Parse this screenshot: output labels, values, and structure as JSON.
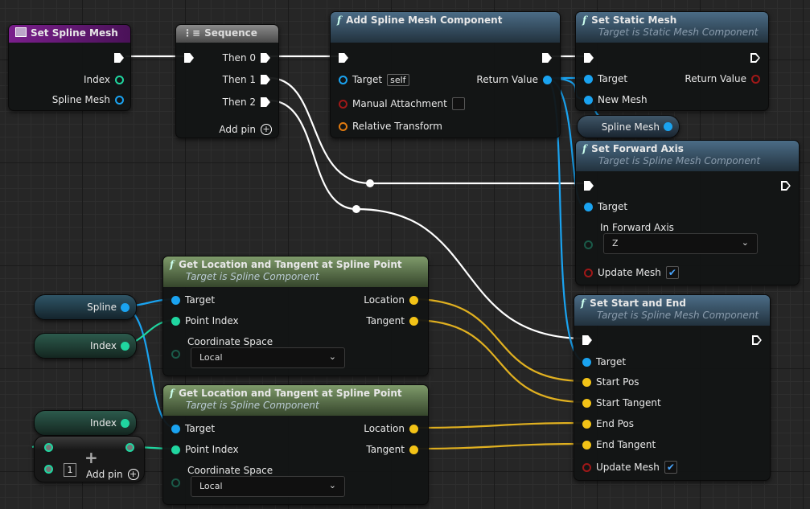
{
  "nodes": {
    "set_spline_mesh": {
      "title": "Set Spline Mesh",
      "pins": [
        "Index",
        "Spline Mesh"
      ]
    },
    "sequence": {
      "title": "Sequence",
      "pins": [
        "Then 0",
        "Then 1",
        "Then 2"
      ],
      "add_pin": "Add pin"
    },
    "add_spline_mesh": {
      "title": "Add Spline Mesh Component",
      "target": "Target",
      "self": "self",
      "manual": "Manual Attachment",
      "relative": "Relative Transform",
      "return": "Return Value"
    },
    "set_static_mesh": {
      "title": "Set Static Mesh",
      "subtitle": "Target is Static Mesh Component",
      "target": "Target",
      "new_mesh": "New Mesh",
      "return": "Return Value"
    },
    "spline_mesh_var": {
      "label": "Spline Mesh"
    },
    "set_forward_axis": {
      "title": "Set Forward Axis",
      "subtitle": "Target is Spline Mesh Component",
      "target": "Target",
      "axis_label": "In Forward Axis",
      "axis_value": "Z",
      "update": "Update Mesh",
      "update_checked": true
    },
    "get_loc_1": {
      "title": "Get Location and Tangent at Spline Point",
      "subtitle": "Target is Spline Component",
      "target": "Target",
      "point_index": "Point Index",
      "coord": "Coordinate Space",
      "coord_value": "Local",
      "location": "Location",
      "tangent": "Tangent"
    },
    "get_loc_2": {
      "title": "Get Location and Tangent at Spline Point",
      "subtitle": "Target is Spline Component",
      "target": "Target",
      "point_index": "Point Index",
      "coord": "Coordinate Space",
      "coord_value": "Local",
      "location": "Location",
      "tangent": "Tangent"
    },
    "set_start_end": {
      "title": "Set Start and End",
      "subtitle": "Target is Spline Mesh Component",
      "target": "Target",
      "start_pos": "Start Pos",
      "start_tangent": "Start Tangent",
      "end_pos": "End Pos",
      "end_tangent": "End Tangent",
      "update": "Update Mesh",
      "update_checked": true
    },
    "spline_var": {
      "label": "Spline"
    },
    "index_var_1": {
      "label": "Index"
    },
    "index_var_2": {
      "label": "Index"
    },
    "add_node": {
      "value": "1",
      "add_pin": "Add pin",
      "symbol": "+"
    }
  },
  "colors": {
    "exec": "#ffffff",
    "object": "#1aa3f0",
    "integer": "#20d6a0",
    "vector": "#f3c317",
    "bool": "#a01818",
    "transform": "#e07a10"
  }
}
